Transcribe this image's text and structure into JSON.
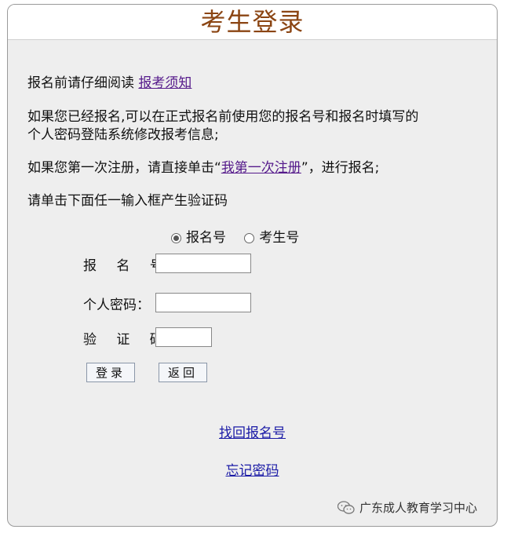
{
  "title": "考生登录",
  "intro": {
    "line1_prefix": "报名前请仔细阅读",
    "line1_link": "报考须知",
    "line2a": "如果您已经报名,可以在正式报名前使用您的报名号和报名时填写的",
    "line2b": "个人密码登陆系统修改报考信息;",
    "line3_prefix": "如果您第一次注册，请直接单击“",
    "line3_link": "我第一次注册",
    "line3_suffix": "”，进行报名;",
    "line4": "请单击下面任一输入框产生验证码"
  },
  "login_type": {
    "options": [
      "报名号",
      "考生号"
    ],
    "selected": "报名号"
  },
  "form": {
    "reg_label": "报 名 号：",
    "password_label": "个人密码：",
    "captcha_label": "验 证 码：",
    "reg_value": "",
    "password_value": "",
    "captcha_value": ""
  },
  "buttons": {
    "login": "登录",
    "back": "返回"
  },
  "links": {
    "find_reg": "找回报名号",
    "forgot_password": "忘记密码"
  },
  "watermark": "广东成人教育学习中心"
}
